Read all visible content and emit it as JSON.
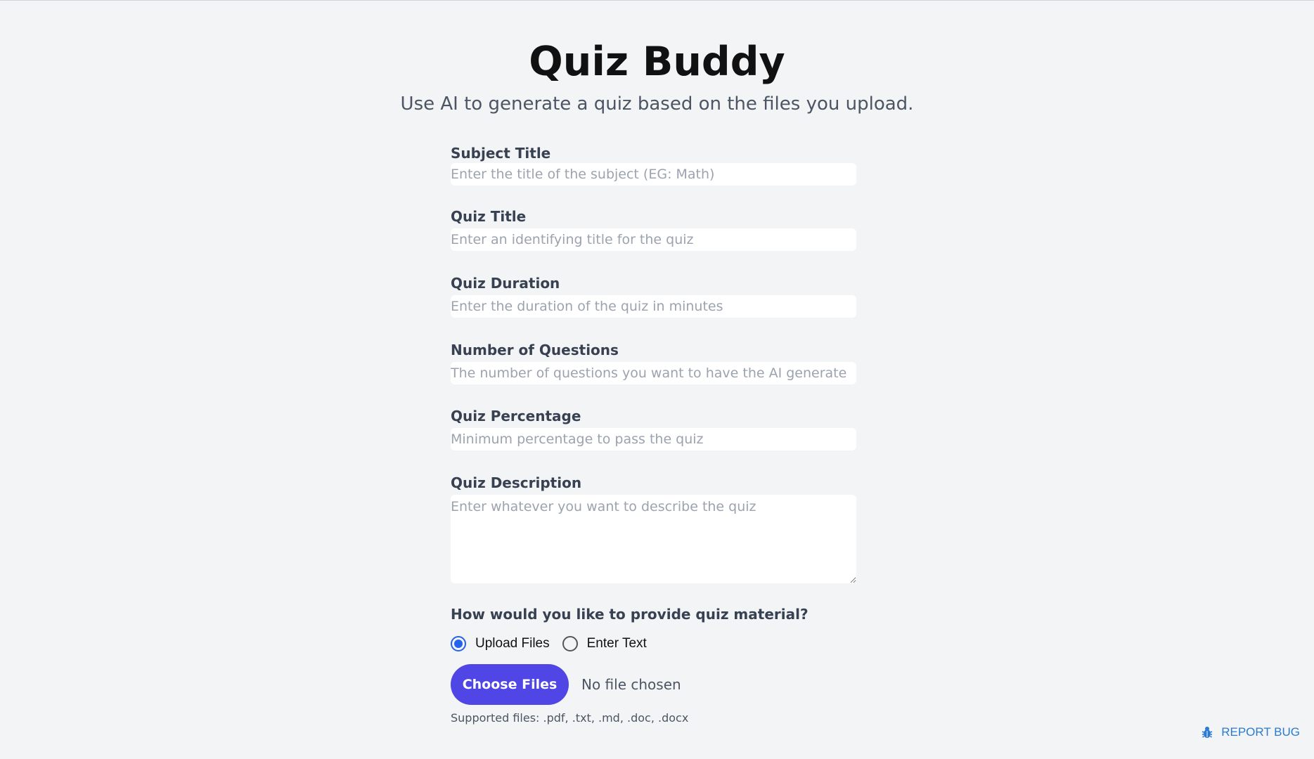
{
  "header": {
    "title": "Quiz Buddy",
    "subtitle": "Use AI to generate a quiz based on the files you upload."
  },
  "form": {
    "subject_title": {
      "label": "Subject Title",
      "placeholder": "Enter the title of the subject (EG: Math)",
      "value": ""
    },
    "quiz_title": {
      "label": "Quiz Title",
      "placeholder": "Enter an identifying title for the quiz",
      "value": ""
    },
    "quiz_duration": {
      "label": "Quiz Duration",
      "placeholder": "Enter the duration of the quiz in minutes",
      "value": ""
    },
    "num_questions": {
      "label": "Number of Questions",
      "placeholder": "The number of questions you want to have the AI generate",
      "value": ""
    },
    "quiz_percentage": {
      "label": "Quiz Percentage",
      "placeholder": "Minimum percentage to pass the quiz",
      "value": ""
    },
    "quiz_description": {
      "label": "Quiz Description",
      "placeholder": "Enter whatever you want to describe the quiz",
      "value": ""
    },
    "material": {
      "question": "How would you like to provide quiz material?",
      "options": [
        {
          "label": "Upload Files",
          "selected": true
        },
        {
          "label": "Enter Text",
          "selected": false
        }
      ]
    },
    "file_upload": {
      "button_label": "Choose Files",
      "status": "No file chosen",
      "supported": "Supported files: .pdf, .txt, .md, .doc, .docx"
    }
  },
  "report_bug": {
    "label": "REPORT BUG",
    "icon": "bug-icon"
  },
  "colors": {
    "background": "#f3f4f6",
    "accent": "#4f46e5",
    "radio_selected": "#2563eb",
    "link": "#2b7bd1"
  }
}
